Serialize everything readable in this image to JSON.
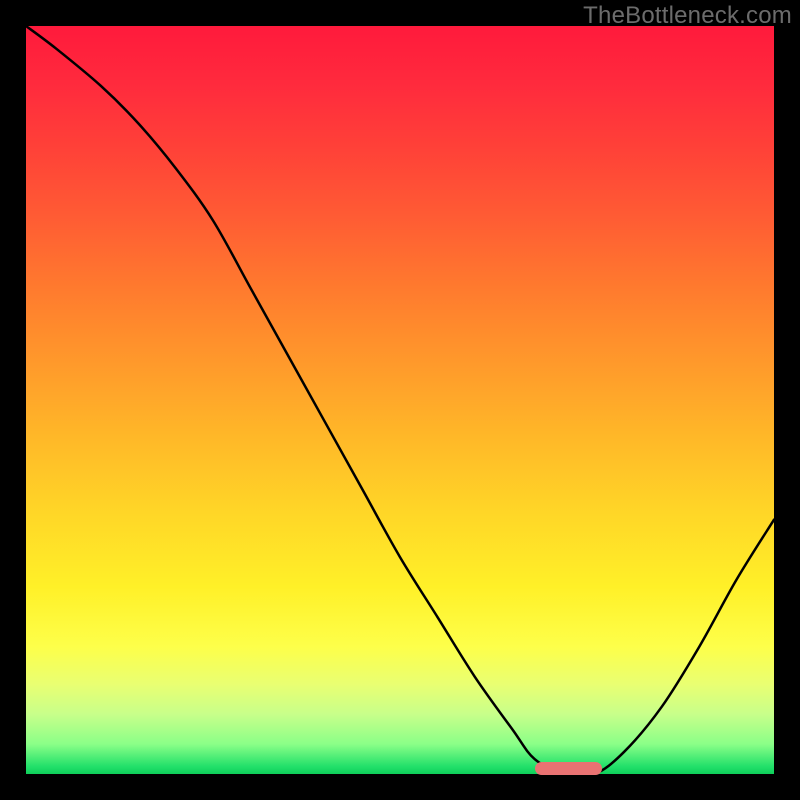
{
  "watermark": "TheBottleneck.com",
  "colors": {
    "frame": "#000000",
    "curve": "#000000",
    "marker": "#e97272",
    "watermark": "#6c6c6c",
    "gradient_stops": [
      "#ff1a3c",
      "#ff2b3d",
      "#ff4038",
      "#ff5a34",
      "#ff7a2e",
      "#ff992b",
      "#ffb828",
      "#ffd627",
      "#fff028",
      "#fdff4a",
      "#e9ff72",
      "#c8ff8a",
      "#8bff88",
      "#22e06a",
      "#0ecf5a"
    ]
  },
  "chart_data": {
    "type": "line",
    "title": "",
    "xlabel": "",
    "ylabel": "",
    "xlim": [
      0,
      100
    ],
    "ylim": [
      0,
      100
    ],
    "grid": false,
    "legend": false,
    "series": [
      {
        "name": "bottleneck-curve",
        "x": [
          0,
          4,
          10,
          15,
          20,
          25,
          30,
          35,
          40,
          45,
          50,
          55,
          60,
          65,
          68,
          72,
          76,
          80,
          85,
          90,
          95,
          100
        ],
        "y": [
          100,
          97,
          92,
          87,
          81,
          74,
          65,
          56,
          47,
          38,
          29,
          21,
          13,
          6,
          2,
          0,
          0,
          3,
          9,
          17,
          26,
          34
        ]
      }
    ],
    "annotations": [
      {
        "name": "optimal-range-marker",
        "x_start": 68,
        "x_end": 77,
        "y": 0
      }
    ],
    "background": "vertical-gradient red→orange→yellow→green"
  }
}
